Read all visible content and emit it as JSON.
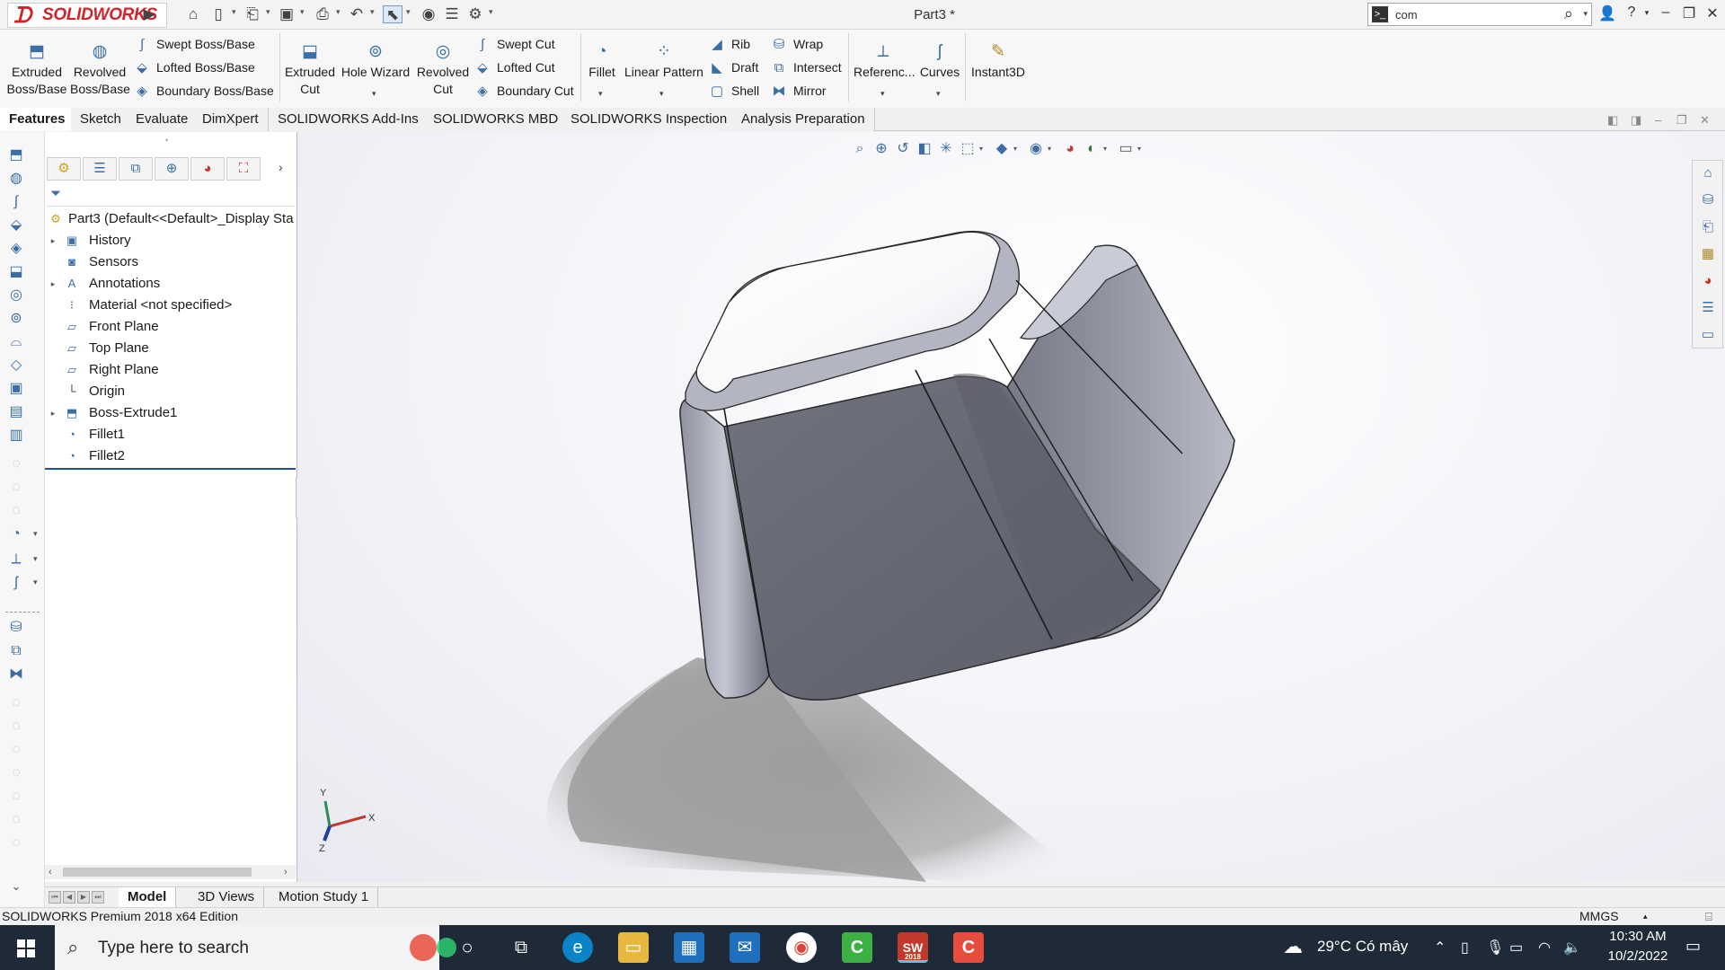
{
  "app": {
    "brand": "SOLIDWORKS",
    "doc_title": "Part3 *"
  },
  "search": {
    "value": "com"
  },
  "commands": {
    "extruded_boss": "Extruded Boss/Base",
    "revolved_boss": "Revolved Boss/Base",
    "swept_boss": "Swept Boss/Base",
    "lofted_boss": "Lofted Boss/Base",
    "boundary_boss": "Boundary Boss/Base",
    "extruded_cut": "Extruded Cut",
    "hole_wizard": "Hole Wizard",
    "revolved_cut": "Revolved Cut",
    "swept_cut": "Swept Cut",
    "lofted_cut": "Lofted Cut",
    "boundary_cut": "Boundary Cut",
    "fillet": "Fillet",
    "linear_pattern": "Linear Pattern",
    "rib": "Rib",
    "draft": "Draft",
    "shell": "Shell",
    "wrap": "Wrap",
    "intersect": "Intersect",
    "mirror": "Mirror",
    "reference": "Referenc...",
    "curves": "Curves",
    "instant3d": "Instant3D"
  },
  "tabs": [
    "Features",
    "Sketch",
    "Evaluate",
    "DimXpert",
    "SOLIDWORKS Add-Ins",
    "SOLIDWORKS MBD",
    "SOLIDWORKS Inspection",
    "Analysis Preparation"
  ],
  "tree": {
    "root": "Part3  (Default<<Default>_Display Sta",
    "items": [
      "History",
      "Sensors",
      "Annotations",
      "Material <not specified>",
      "Front Plane",
      "Top Plane",
      "Right Plane",
      "Origin",
      "Boss-Extrude1",
      "Fillet1",
      "Fillet2"
    ]
  },
  "triad": {
    "x": "X",
    "y": "Y",
    "z": "Z"
  },
  "bottom_tabs": [
    "Model",
    "3D Views",
    "Motion Study 1"
  ],
  "status": {
    "edition": "SOLIDWORKS Premium 2018 x64 Edition",
    "units": "MMGS"
  },
  "taskbar": {
    "search_placeholder": "Type here to search",
    "weather": "29°C  Có mây",
    "time": "10:30 AM",
    "date": "10/2/2022",
    "sw_badge": "2018"
  },
  "colors": {
    "brand_red": "#d2232a",
    "icon_blue": "#3a6ea5",
    "taskbar": "#1f2a38"
  }
}
